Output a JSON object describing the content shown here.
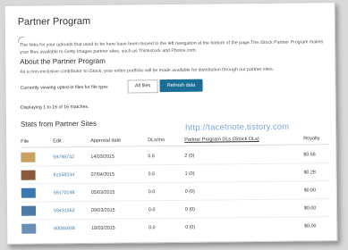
{
  "page": {
    "title": "Partner Program",
    "notice": "The links for your uploads that used to be here have been moved to the left navigation at the bottom of the page.The iStock Partner Program makes your files available to Getty Images partner sites, such as Thinkstock and Photos.com.",
    "about_title": "About the Partner Program",
    "about_body": "As a non-exclusive contributor to iStock, your entire portfolio will be made available for distribution through our partner sites.",
    "filter_label": "Currently viewing opted-in files for file type:",
    "filter_value": "All files",
    "refresh_label": "Refresh data",
    "count_text": "Displaying 1 to 16 of 16 matches.",
    "stats_title": "Stats from Partner Sites",
    "watermark": "http://tacetnote.tistory.com"
  },
  "table": {
    "headers": [
      "File",
      "Edit",
      "Approval date",
      "DLs/mo",
      "Partner Program DLs (iStock DLs)",
      "Royalty"
    ],
    "rows": [
      {
        "edit": "59798742",
        "date": "14/03/2015",
        "dls": "0.8",
        "pp": "2 (0)",
        "royalty": "$0.56",
        "thumb_color": "#c8a060"
      },
      {
        "edit": "61558244",
        "date": "07/04/2015",
        "dls": "0.5",
        "pp": "1 (0)",
        "royalty": "$0.28",
        "thumb_color": "#8a5a3a"
      },
      {
        "edit": "59170198",
        "date": "05/03/2015",
        "dls": "0.0",
        "pp": "0 (0)",
        "royalty": "$0.00",
        "thumb_color": "#3b78b0"
      },
      {
        "edit": "59431562",
        "date": "09/03/2015",
        "dls": "0.0",
        "pp": "0 (0)",
        "royalty": "$0.00",
        "thumb_color": "#4a7aa8"
      },
      {
        "edit": "60084938",
        "date": "18/03/2015",
        "dls": "0.0",
        "pp": "0 (0)",
        "royalty": "$0.00",
        "thumb_color": "#6a8fb5"
      }
    ]
  }
}
